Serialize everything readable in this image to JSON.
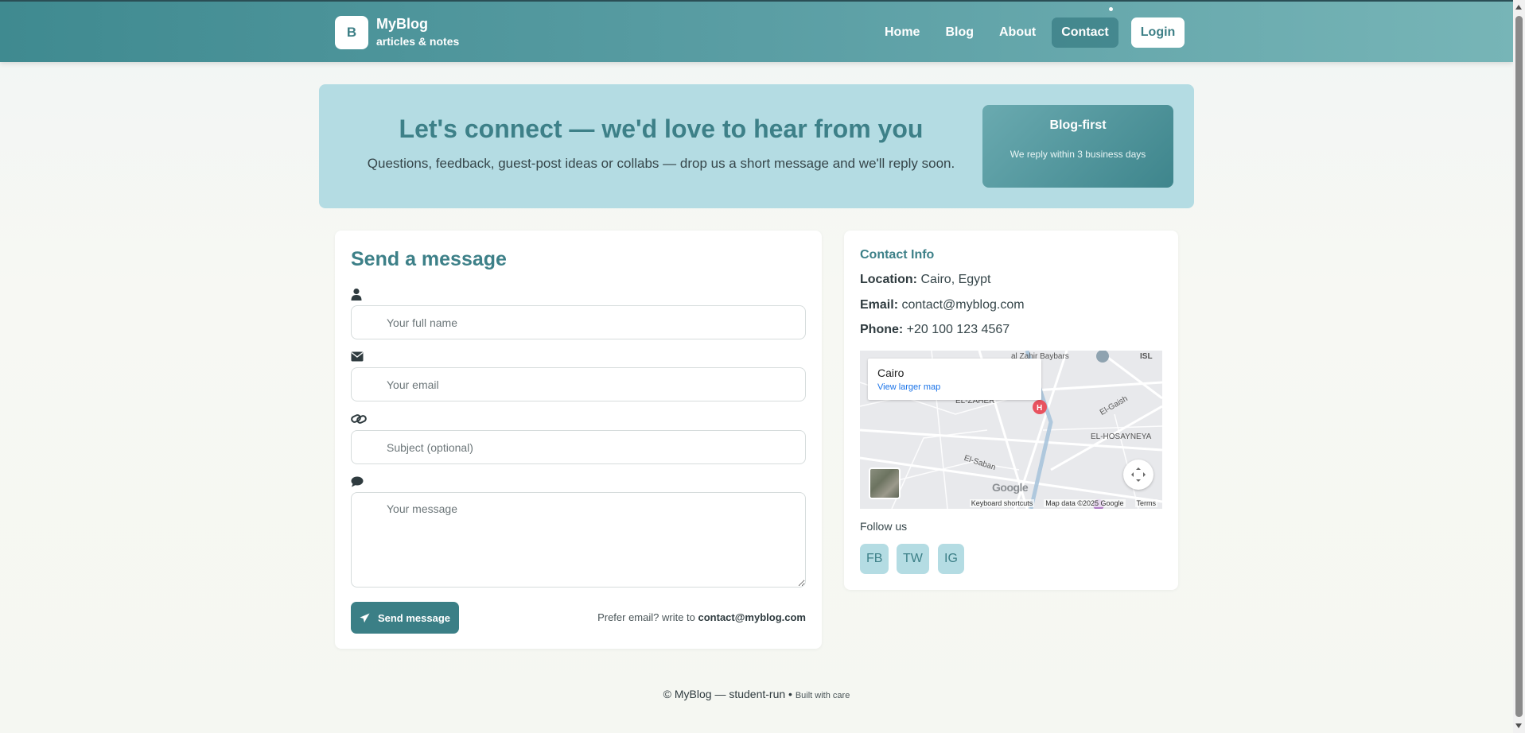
{
  "header": {
    "logo_letter": "B",
    "brand_name": "MyBlog",
    "brand_tagline": "articles & notes",
    "nav": [
      {
        "label": "Home"
      },
      {
        "label": "Blog"
      },
      {
        "label": "About"
      },
      {
        "label": "Contact",
        "active": true
      }
    ],
    "login_label": "Login"
  },
  "hero": {
    "title": "Let's connect — we'd love to hear from you",
    "subtitle": "Questions, feedback, guest-post ideas or collabs — drop us a short message and we'll reply soon.",
    "card_title": "Blog-first",
    "card_subtitle": "We reply within 3 business days"
  },
  "form": {
    "title": "Send a message",
    "name_placeholder": "Your full name",
    "email_placeholder": "Your email",
    "subject_placeholder": "Subject (optional)",
    "message_placeholder": "Your message",
    "send_label": "Send message",
    "prefer_text": "Prefer email? write to",
    "prefer_email": "contact@myblog.com"
  },
  "contact_info": {
    "title": "Contact Info",
    "location_label": "Location:",
    "location_value": "Cairo, Egypt",
    "email_label": "Email:",
    "email_value": "contact@myblog.com",
    "phone_label": "Phone:",
    "phone_value": "+20 100 123 4567",
    "map": {
      "place": "Cairo",
      "link": "View larger map",
      "labels": {
        "zahir": "al Zahir Baybars",
        "zaher": "EL-ZAHER",
        "gaish": "El-Gaish",
        "hosayneya": "EL-HOSAYNEYA",
        "saban": "El-Saban",
        "isl": "ISL"
      },
      "google": "Google",
      "shortcuts": "Keyboard shortcuts",
      "map_data": "Map data ©2025 Google",
      "terms": "Terms"
    },
    "follow_label": "Follow us",
    "social": [
      "FB",
      "TW",
      "IG"
    ]
  },
  "footer": {
    "text": "© MyBlog — student-run •",
    "small": "Built with care"
  },
  "colors": {
    "accent": "#3d8088",
    "hero_bg": "#b4dce3",
    "button": "#3b7f86"
  }
}
